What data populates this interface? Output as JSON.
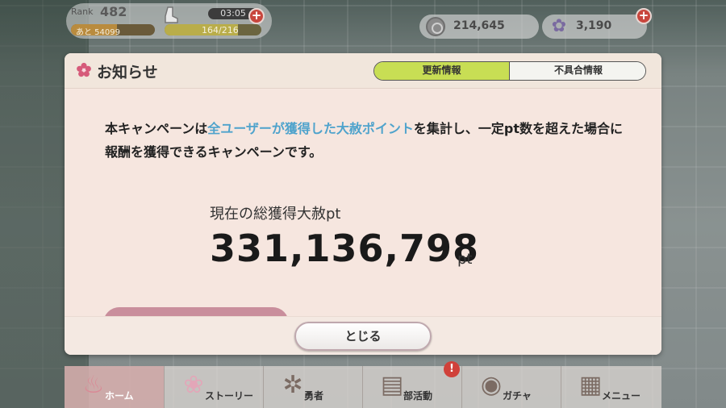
{
  "hud": {
    "rank_label": "Rank",
    "rank_value": "482",
    "rank_next": "あと 54099",
    "rank_progress": 0.55,
    "stamina_timer": "03:05",
    "stamina_value": "164/216",
    "stamina_progress": 0.76,
    "coins": "214,645",
    "gems": "3,190",
    "plus_symbol": "+"
  },
  "modal": {
    "title": "お知らせ",
    "tabs": [
      {
        "label": "更新情報",
        "active": true
      },
      {
        "label": "不具合情報",
        "active": false
      }
    ],
    "description": {
      "part1": "本キャンペーンは",
      "highlight": "全ユーザーが獲得した大赦ポイント",
      "part2": "を集計し、一定pt数を超えた場合に報酬を獲得できるキャンペーンです。"
    },
    "total_label": "現在の総獲得大赦pt",
    "total_value": "331,136,798",
    "total_unit": "pt",
    "close_label": "とじる"
  },
  "nav": {
    "items": [
      {
        "label": "ホーム",
        "icon": "home-icon"
      },
      {
        "label": "ストーリー",
        "icon": "story-icon"
      },
      {
        "label": "勇者",
        "icon": "hero-icon"
      },
      {
        "label": "部活動",
        "icon": "club-icon"
      },
      {
        "label": "ガチャ",
        "icon": "gacha-icon"
      },
      {
        "label": "メニュー",
        "icon": "menu-icon"
      }
    ],
    "alert_symbol": "!"
  },
  "colors": {
    "tab_active": "#c8de54",
    "highlight_text": "#4fa3cc",
    "modal_bg": "#f6e7e1",
    "alert": "#d0413a"
  }
}
